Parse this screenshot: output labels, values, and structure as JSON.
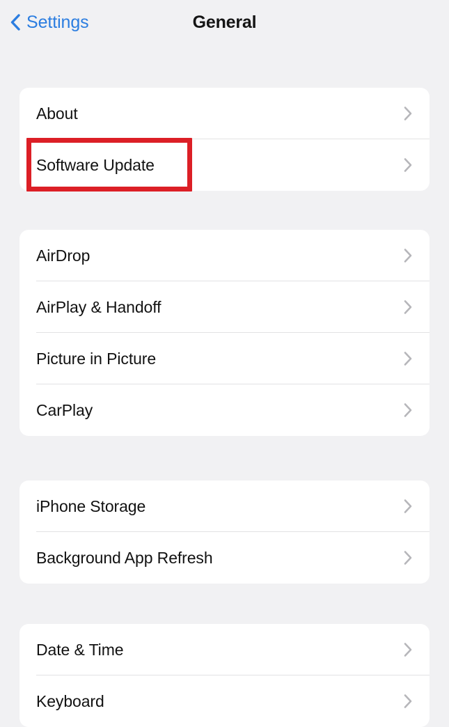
{
  "app": {
    "platform": "ios-settings",
    "background_color": "#f1f1f3",
    "card_color": "#ffffff",
    "accent_color": "#2b7de0",
    "chevron_color": "#b6b6ba",
    "separator_color": "#e2e2e4"
  },
  "navbar": {
    "back_label": "Settings",
    "back_icon": "chevron-left-icon",
    "title": "General"
  },
  "annotation": {
    "type": "highlight-box",
    "color": "#dc1f26",
    "target_label": "Software Update",
    "stroke_width": "7px"
  },
  "sections": [
    {
      "id": "system-info",
      "rows": [
        {
          "label": "About",
          "accessory": "chevron-right-icon"
        },
        {
          "label": "Software Update",
          "accessory": "chevron-right-icon"
        }
      ]
    },
    {
      "id": "connectivity",
      "rows": [
        {
          "label": "AirDrop",
          "accessory": "chevron-right-icon"
        },
        {
          "label": "AirPlay & Handoff",
          "accessory": "chevron-right-icon"
        },
        {
          "label": "Picture in Picture",
          "accessory": "chevron-right-icon"
        },
        {
          "label": "CarPlay",
          "accessory": "chevron-right-icon"
        }
      ]
    },
    {
      "id": "storage",
      "rows": [
        {
          "label": "iPhone Storage",
          "accessory": "chevron-right-icon"
        },
        {
          "label": "Background App Refresh",
          "accessory": "chevron-right-icon"
        }
      ]
    },
    {
      "id": "system-prefs",
      "rows": [
        {
          "label": "Date & Time",
          "accessory": "chevron-right-icon"
        },
        {
          "label": "Keyboard",
          "accessory": "chevron-right-icon"
        }
      ]
    }
  ]
}
